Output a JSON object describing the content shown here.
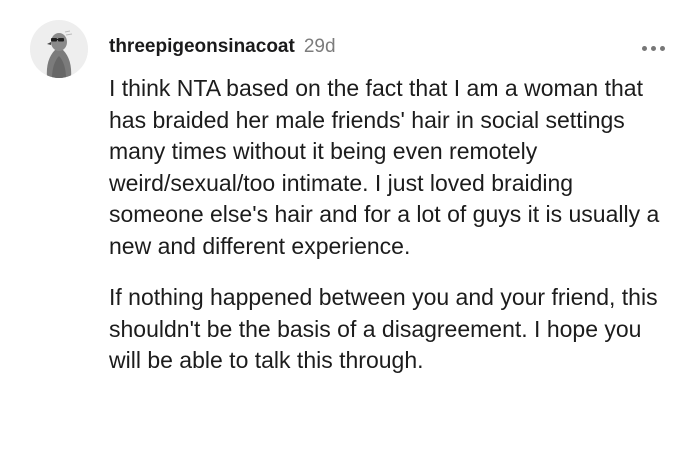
{
  "comment": {
    "author": "threepigeonsinacoat",
    "timestamp": "29d",
    "more_icon": "more-horizontal-icon",
    "avatar_icon": "pigeon-avatar",
    "paragraphs": [
      "I think NTA based on the fact that I am a woman that has braided her male friends' hair in social settings many times without it being even remotely weird/sexual/too intimate. I just loved braiding someone else's hair and for a lot of guys it is usually a new and different experience.",
      "If nothing happened between you and your friend, this shouldn't be the basis of a disagreement. I hope you will be able to talk this through."
    ]
  }
}
